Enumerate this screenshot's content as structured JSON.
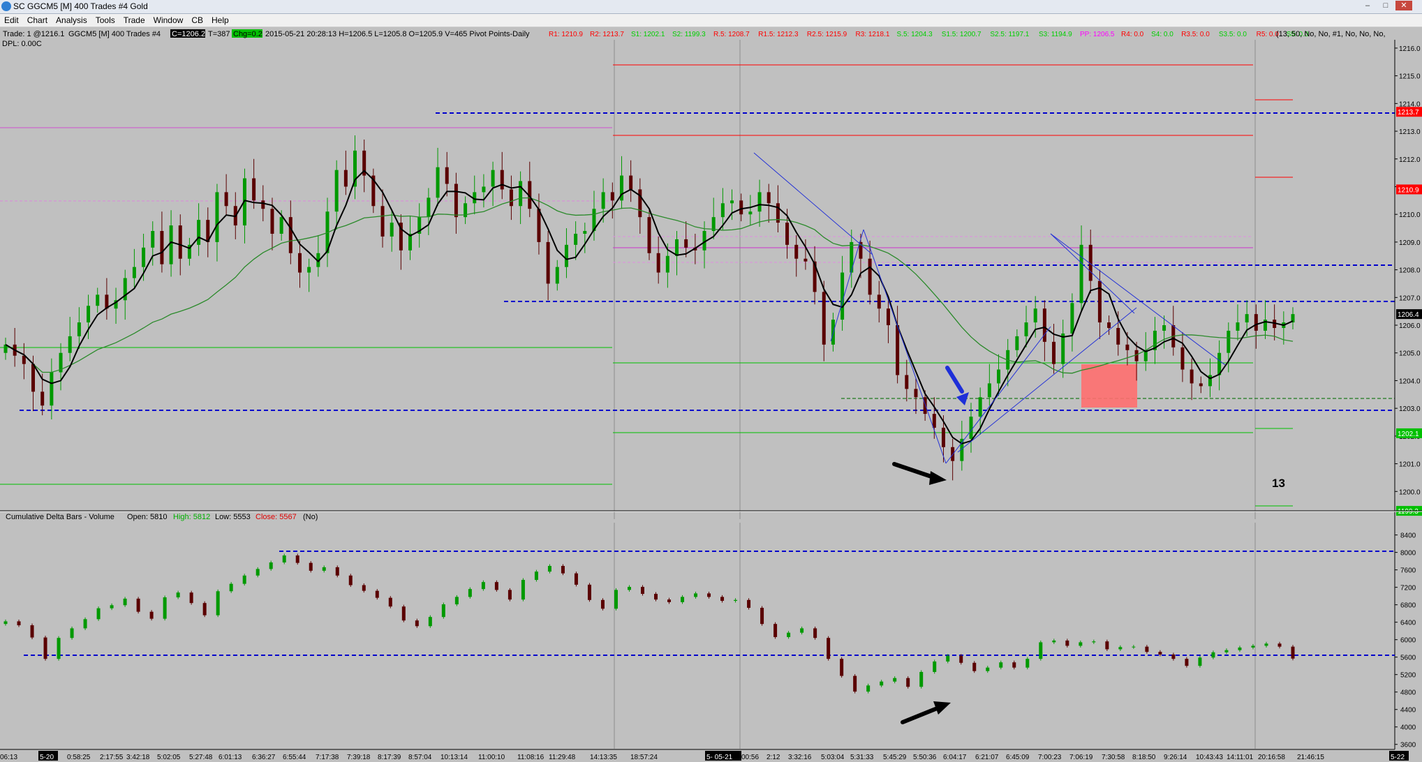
{
  "window": {
    "title": "SC GGCM5 [M]  400 Trades  #4  Gold",
    "controls": [
      "–",
      "□",
      "✕"
    ]
  },
  "menu": [
    "Edit",
    "Chart",
    "Analysis",
    "Tools",
    "Trade",
    "Window",
    "CB",
    "Help"
  ],
  "info_bar": {
    "trade_badge": "Trade: 1 @1216.1",
    "symbol": "GGCM5 [M]  400 Trades  #4",
    "current_badge": "C=1206.2",
    "ticks": "T=387",
    "change_badge": "Chg=0.2",
    "ohlc": "2015-05-21 20:28:13 H=1206.5 L=1205.8 O=1205.9 V=465 Pivot Points-Daily",
    "settings": "(13, 50, No, No, #1, No, No, No,",
    "dpl": "DPL: 0.00C",
    "pivots": [
      {
        "text": "R1: 1210.9",
        "color": "#ff0000"
      },
      {
        "text": "R2: 1213.7",
        "color": "#ff0000"
      },
      {
        "text": "S1: 1202.1",
        "color": "#00d000"
      },
      {
        "text": "S2: 1199.3",
        "color": "#00d000"
      },
      {
        "text": "R.5: 1208.7",
        "color": "#ff0000"
      },
      {
        "text": "R1.5: 1212.3",
        "color": "#ff0000"
      },
      {
        "text": "R2.5: 1215.9",
        "color": "#ff0000"
      },
      {
        "text": "R3: 1218.1",
        "color": "#ff0000"
      },
      {
        "text": "S.5: 1204.3",
        "color": "#00d000"
      },
      {
        "text": "S1.5: 1200.7",
        "color": "#00d000"
      },
      {
        "text": "S2.5: 1197.1",
        "color": "#00d000"
      },
      {
        "text": "S3: 1194.9",
        "color": "#00d000"
      },
      {
        "text": "PP: 1206.5",
        "color": "#ff00ff"
      },
      {
        "text": "R4: 0.0",
        "color": "#ff0000"
      },
      {
        "text": "S4: 0.0",
        "color": "#00d000"
      },
      {
        "text": "R3.5: 0.0",
        "color": "#ff0000"
      },
      {
        "text": "S3.5: 0.0",
        "color": "#00d000"
      },
      {
        "text": "R5: 0.0",
        "color": "#ff0000"
      },
      {
        "text": "S5: 0.0",
        "color": "#00d000"
      }
    ]
  },
  "price_axis": {
    "ticks": [
      "1216.0",
      "1215.0",
      "1214.0",
      "1213.0",
      "1212.0",
      "1211.0",
      "1210.0",
      "1209.0",
      "1208.0",
      "1207.0",
      "1206.0",
      "1205.0",
      "1204.0",
      "1203.0",
      "1202.0",
      "1201.0",
      "1200.0"
    ],
    "badges": [
      {
        "text": "1213.7",
        "price": 1213.7,
        "color": "#ff0000"
      },
      {
        "text": "1210.9",
        "price": 1210.9,
        "color": "#ff0000"
      },
      {
        "text": "1206.4",
        "price": 1206.4,
        "color": "#000000"
      },
      {
        "text": "1202.1",
        "price": 1202.1,
        "color": "#00c000"
      },
      {
        "text": "1199.3",
        "price": 1199.3,
        "color": "#00c000"
      }
    ]
  },
  "bar_count_label": "13",
  "delta_panel": {
    "title": "Cumulative Delta Bars - Volume",
    "open": "Open: 5810",
    "high": "High: 5812",
    "low": "Low: 5553",
    "close": "Close: 5567",
    "mode": "(No)",
    "axis_ticks": [
      "8400",
      "8000",
      "7600",
      "7200",
      "6800",
      "6400",
      "6000",
      "5600",
      "5200",
      "4800",
      "4400",
      "4000",
      "3600"
    ]
  },
  "time_axis": {
    "labels": [
      "06:13",
      "5-20",
      "0:58:25",
      "2:17:55",
      "3:42:18",
      "5:02:05",
      "5:27:48",
      "6:01:13",
      "6:36:27",
      "6:55:44",
      "7:17:38",
      "7:39:18",
      "8:17:39",
      "8:57:04",
      "10:13:14",
      "11:00:10",
      "11:08:16",
      "11:29:48",
      "14:13:35",
      "18:57:24",
      "5- 05-21",
      "00:56",
      "2:12",
      "3:32:16",
      "5:03:04",
      "5:31:33",
      "5:45:29",
      "5:50:36",
      "6:04:17",
      "6:21:07",
      "6:45:09",
      "7:00:23",
      "7:06:19",
      "7:30:58",
      "8:18:50",
      "9:26:14",
      "10:43:43",
      "14:11:01",
      "20:16:58",
      "21:46:15",
      "5-22"
    ]
  },
  "chart_data": {
    "type": "candlestick",
    "symbol": "GGCM5",
    "price_ylim": [
      1199.0,
      1216.3
    ],
    "delta_ylim": [
      3500,
      8650
    ],
    "close_series": [
      1205.3,
      1204.9,
      1204.6,
      1203.6,
      1203.1,
      1204.3,
      1205.0,
      1205.6,
      1206.1,
      1206.7,
      1207.1,
      1206.6,
      1206.9,
      1207.7,
      1208.1,
      1208.8,
      1209.4,
      1208.2,
      1209.6,
      1208.4,
      1208.9,
      1209.8,
      1209.0,
      1210.8,
      1210.3,
      1209.6,
      1211.3,
      1210.5,
      1210.2,
      1209.3,
      1209.9,
      1208.6,
      1207.9,
      1208.1,
      1208.6,
      1210.1,
      1211.6,
      1211.0,
      1212.3,
      1211.4,
      1210.3,
      1209.2,
      1209.7,
      1208.7,
      1209.3,
      1209.9,
      1210.6,
      1211.7,
      1211.1,
      1209.9,
      1210.4,
      1210.8,
      1211.0,
      1211.6,
      1210.9,
      1210.3,
      1211.2,
      1210.2,
      1209.0,
      1207.5,
      1208.1,
      1208.9,
      1209.3,
      1209.4,
      1210.2,
      1210.8,
      1210.5,
      1211.4,
      1210.9,
      1209.9,
      1208.6,
      1207.9,
      1208.5,
      1209.1,
      1208.8,
      1208.7,
      1209.4,
      1209.9,
      1210.4,
      1210.5,
      1210.0,
      1210.1,
      1210.8,
      1210.4,
      1209.7,
      1208.9,
      1208.4,
      1208.3,
      1207.2,
      1205.3,
      1206.2,
      1207.9,
      1209.0,
      1208.4,
      1207.1,
      1206.6,
      1206.0,
      1204.2,
      1203.7,
      1203.4,
      1202.8,
      1202.3,
      1201.6,
      1201.1,
      1201.9,
      1202.7,
      1203.4,
      1203.9,
      1204.4,
      1205.1,
      1205.6,
      1206.1,
      1206.6,
      1205.4,
      1204.6,
      1205.7,
      1206.8,
      1208.9,
      1207.6,
      1206.1,
      1205.9,
      1205.3,
      1205.1,
      1204.7,
      1205.1,
      1205.8,
      1206.0,
      1205.2,
      1204.4,
      1203.9,
      1203.8,
      1204.2,
      1205.0,
      1205.8,
      1206.1,
      1206.4,
      1205.8,
      1206.2,
      1205.9,
      1206.1,
      1206.4
    ],
    "delta_close_series": [
      6420,
      6330,
      6050,
      5560,
      6040,
      6260,
      6470,
      6720,
      6790,
      6940,
      6640,
      6480,
      6970,
      7080,
      6840,
      6560,
      7110,
      7280,
      7470,
      7620,
      7770,
      7930,
      7760,
      7580,
      7660,
      7470,
      7250,
      7120,
      6960,
      6760,
      6440,
      6310,
      6520,
      6810,
      6980,
      7160,
      7320,
      7140,
      6920,
      7370,
      7560,
      7690,
      7520,
      7260,
      6910,
      6710,
      7140,
      7210,
      7050,
      6920,
      6860,
      6980,
      7060,
      6980,
      6890,
      6910,
      6730,
      6360,
      6060,
      6160,
      6260,
      6040,
      5560,
      5170,
      4810,
      4950,
      5040,
      5120,
      4920,
      5260,
      5500,
      5630,
      5470,
      5280,
      5360,
      5480,
      5360,
      5560,
      5940,
      5980,
      5860,
      5940,
      5960,
      5780,
      5830,
      5840,
      5720,
      5660,
      5560,
      5400,
      5590,
      5710,
      5760,
      5820,
      5860,
      5910,
      5840,
      5567
    ],
    "moving_averages": [
      {
        "name": "MA 13",
        "color": "#000000"
      },
      {
        "name": "MA 50",
        "color": "#2b8a2b"
      }
    ],
    "horizontal_levels": [
      1213.7,
      1210.9,
      1208.0,
      1206.4,
      1203.4,
      1202.8,
      1202.1,
      1199.3
    ],
    "delta_levels": [
      8000,
      5600
    ],
    "grid": false,
    "colors": {
      "up": "#009900",
      "down": "#5a0000",
      "level": "#0000cc",
      "resistance": "#ff0000",
      "support": "#00c000",
      "pivot": "#ff00ff",
      "zone": "#ff6f6f"
    }
  }
}
